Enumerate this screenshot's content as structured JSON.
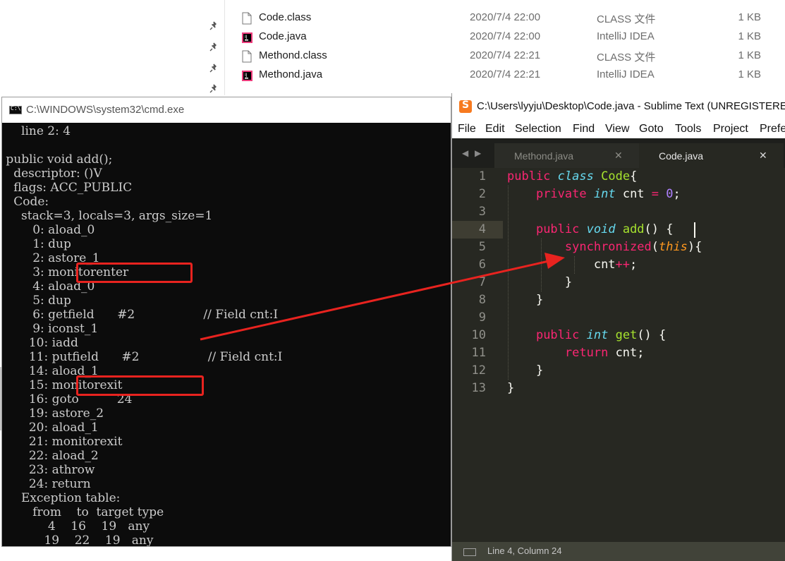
{
  "explorer": {
    "files": [
      {
        "name": "Code.class",
        "date": "2020/7/4 22:00",
        "type": "CLASS 文件",
        "size": "1 KB",
        "icon": "file-icon"
      },
      {
        "name": "Code.java",
        "date": "2020/7/4 22:00",
        "type": "IntelliJ IDEA",
        "size": "1 KB",
        "icon": "intellij-icon"
      },
      {
        "name": "Methond.class",
        "date": "2020/7/4 22:21",
        "type": "CLASS 文件",
        "size": "1 KB",
        "icon": "file-icon"
      },
      {
        "name": "Methond.java",
        "date": "2020/7/4 22:21",
        "type": "IntelliJ IDEA",
        "size": "1 KB",
        "icon": "intellij-icon"
      }
    ]
  },
  "cmd": {
    "title": "C:\\WINDOWS\\system32\\cmd.exe",
    "icon_label": "C:\\",
    "lines": [
      "     line 2: 4",
      "",
      " public void add();",
      "   descriptor: ()V",
      "   flags: ACC_PUBLIC",
      "   Code:",
      "     stack=3, locals=3, args_size=1",
      "        0: aload_0",
      "        1: dup",
      "        2: astore_1",
      "        3: monitorenter",
      "        4: aload_0",
      "        5: dup",
      "        6: getfield      #2                  // Field cnt:I",
      "        9: iconst_1",
      "       10: iadd",
      "       11: putfield      #2                  // Field cnt:I",
      "       14: aload_1",
      "       15: monitorexit",
      "       16: goto          24",
      "       19: astore_2",
      "       20: aload_1",
      "       21: monitorexit",
      "       22: aload_2",
      "       23: athrow",
      "       24: return",
      "     Exception table:",
      "        from    to  target type",
      "            4    16    19   any",
      "           19    22    19   any"
    ]
  },
  "sublime": {
    "title": "C:\\Users\\lyyju\\Desktop\\Code.java - Sublime Text (UNREGISTERED)",
    "app_icon_label": "S",
    "menu": [
      "File",
      "Edit",
      "Selection",
      "Find",
      "View",
      "Goto",
      "Tools",
      "Project",
      "Preferences"
    ],
    "nav_prev": "◀",
    "nav_next": "▶",
    "tabs": [
      {
        "label": "Methond.java",
        "close": "✕"
      },
      {
        "label": "Code.java",
        "close": "✕"
      }
    ],
    "line_numbers": [
      "1",
      "2",
      "3",
      "4",
      "5",
      "6",
      "7",
      "8",
      "9",
      "10",
      "11",
      "12",
      "13"
    ],
    "code": {
      "l1": {
        "a": "public",
        "b": "class",
        "c": "Code",
        "d": "{"
      },
      "l2": {
        "a": "private",
        "b": "int",
        "c": "cnt",
        "d": "=",
        "e": "0",
        "f": ";"
      },
      "l4": {
        "a": "public",
        "b": "void",
        "c": "add",
        "d": "() {"
      },
      "l5": {
        "a": "synchronized",
        "b": "(",
        "c": "this",
        "d": "){"
      },
      "l6": {
        "a": "cnt",
        "b": "++",
        "c": ";"
      },
      "l7": "}",
      "l8": "}",
      "l10": {
        "a": "public",
        "b": "int",
        "c": "get",
        "d": "() {"
      },
      "l11": {
        "a": "return",
        "b": "cnt;"
      },
      "l12": "}",
      "l13": "}"
    },
    "status": "Line 4, Column 24"
  },
  "colors": {
    "annotation_red": "#e8231f",
    "monokai_bg": "#272822",
    "keyword": "#f92672",
    "storage_type": "#66d9ef",
    "class_name": "#a6e22e",
    "number": "#ae81ff"
  }
}
